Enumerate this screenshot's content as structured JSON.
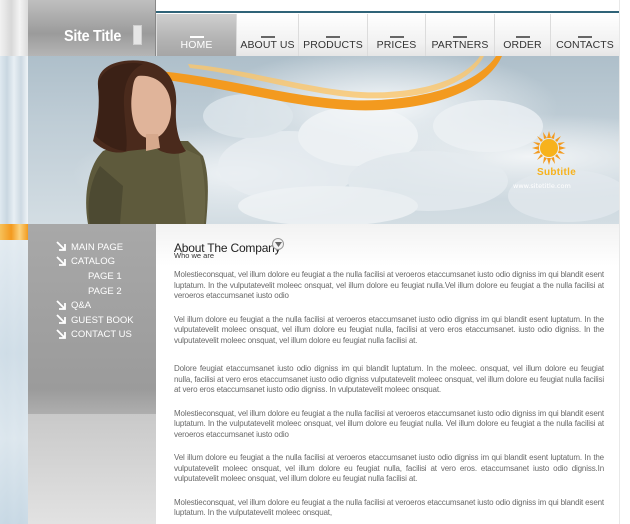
{
  "site": {
    "title": "Site Title",
    "url": "www.sitetitle.com",
    "logo_text": "Subtitle"
  },
  "nav": {
    "items": [
      {
        "label": "HOME",
        "active": true
      },
      {
        "label": "ABOUT US",
        "active": false
      },
      {
        "label": "PRODUCTS",
        "active": false
      },
      {
        "label": "PRICES",
        "active": false
      },
      {
        "label": "PARTNERS",
        "active": false
      },
      {
        "label": "ORDER",
        "active": false
      },
      {
        "label": "CONTACTS",
        "active": false
      }
    ]
  },
  "sidebar": {
    "items": [
      {
        "label": "MAIN PAGE",
        "icon": "arrow-down-right-icon",
        "level": 1
      },
      {
        "label": "CATALOG",
        "icon": "arrow-down-right-icon",
        "level": 1
      },
      {
        "label": "PAGE 1",
        "level": 2
      },
      {
        "label": "PAGE 2",
        "level": 2
      },
      {
        "label": "Q&A",
        "icon": "arrow-down-right-icon",
        "level": 1
      },
      {
        "label": "GUEST BOOK",
        "icon": "arrow-down-right-icon",
        "level": 1
      },
      {
        "label": "CONTACT US",
        "icon": "arrow-down-right-icon",
        "level": 1
      }
    ]
  },
  "main": {
    "heading": "About The Company",
    "subheading": "Who we are",
    "toggle_icon": "chevron-down-icon",
    "paragraphs": [
      "Molestieconsquat, vel illum dolore eu feugiat a the nulla facilisi at veroeros etaccumsanet iusto odio digniss im qui blandit esent luptatum. In the vulputatevelit moleec onsquat, vel illum dolore eu feugiat nulla.Vel illum dolore eu feugiat a the nulla facilisi at veroeros etaccumsanet iusto odio",
      "Vel illum dolore eu feugiat a the nulla facilisi at veroeros etaccumsanet iusto odio digniss im qui blandit esent luptatum. In the vulputatevelit moleec onsquat, vel illum dolore eu feugiat nulla, facilisi at vero eros etaccumsanet. iusto odio digniss. In the vulputatevelit moleec onsquat, vel illum dolore eu feugiat nulla facilisi at.",
      "Dolore feugiat   etaccumsanet iusto odio digniss im qui blandit luptatum. In the moleec. onsquat, vel illum dolore eu feugiat nulla, facilisi at vero eros etaccumsanet iusto odio digniss vulputatevelit moleec onsquat, vel illum dolore eu feugiat nulla facilisi at vero eros etaccumsanet iusto odio digniss. In vulputatevelit moleec onsquat.",
      "Molestieconsquat, vel illum dolore eu feugiat a the nulla facilisi at veroeros etaccumsanet iusto odio digniss im qui blandit esent luptatum. In the vulputatevelit moleec onsquat, vel illum dolore eu feugiat nulla. Vel illum dolore eu feugiat a the nulla facilisi at veroeros etaccumsanet iusto odio",
      "Vel illum dolore eu feugiat a the nulla facilisi at veroeros etaccumsanet iusto odio digniss im qui blandit esent luptatum. In the vulputatevelit moleec onsquat, vel illum dolore eu feugiat nulla, facilisi at vero eros. etaccumsanet iusto odio digniss.In vulputatevelit moleec onsquat, vel illum dolore eu feugiat nulla facilisi at.",
      "Molestieconsquat, vel illum dolore eu feugiat a the nulla facilisi at veroeros etaccumsanet iusto odio digniss im qui blandit esent luptatum. In the vulputatevelit moleec onsquat,"
    ]
  },
  "colors": {
    "nav_line": "#2f6378",
    "accent_orange": "#f39a1f",
    "sidebar_gray": "#a8a8a8",
    "sun_yellow": "#f7b21c"
  }
}
